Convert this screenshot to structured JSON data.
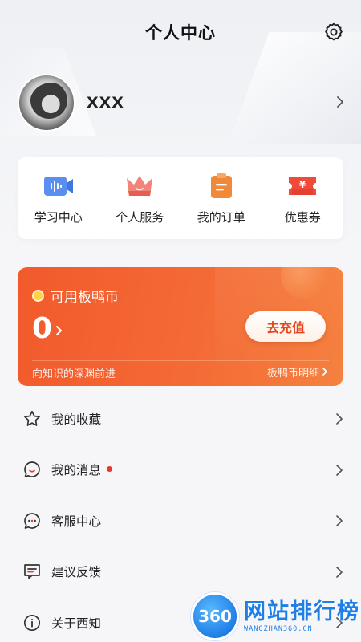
{
  "header": {
    "title": "个人中心",
    "settings_icon": "gear-icon"
  },
  "profile": {
    "name": "XXX"
  },
  "quick_actions": [
    {
      "label": "学习中心",
      "icon": "video-icon",
      "color": "#5a8ff0"
    },
    {
      "label": "个人服务",
      "icon": "crown-icon",
      "color": "#ef6a62"
    },
    {
      "label": "我的订单",
      "icon": "order-icon",
      "color": "#f08a3a"
    },
    {
      "label": "优惠券",
      "icon": "coupon-icon",
      "color": "#ef4a3a"
    }
  ],
  "coin_card": {
    "title": "可用板鸭币",
    "balance": "0",
    "recharge_label": "去充值",
    "slogan": "向知识的深渊前进",
    "detail_label": "板鸭币明细"
  },
  "menu": [
    {
      "label": "我的收藏",
      "icon": "star-icon",
      "dot": false
    },
    {
      "label": "我的消息",
      "icon": "message-icon",
      "dot": true
    },
    {
      "label": "客服中心",
      "icon": "chat-bubble-icon",
      "dot": false
    },
    {
      "label": "建议反馈",
      "icon": "feedback-icon",
      "dot": false
    },
    {
      "label": "关于西知",
      "icon": "info-icon",
      "dot": false
    }
  ],
  "watermark": {
    "logo": "360",
    "title": "网站排行榜",
    "subtitle": "WANGZHAN360.CN"
  },
  "colors": {
    "accent": "#f25a2c",
    "recharge_text": "#e5451d",
    "dot": "#e8372b"
  }
}
